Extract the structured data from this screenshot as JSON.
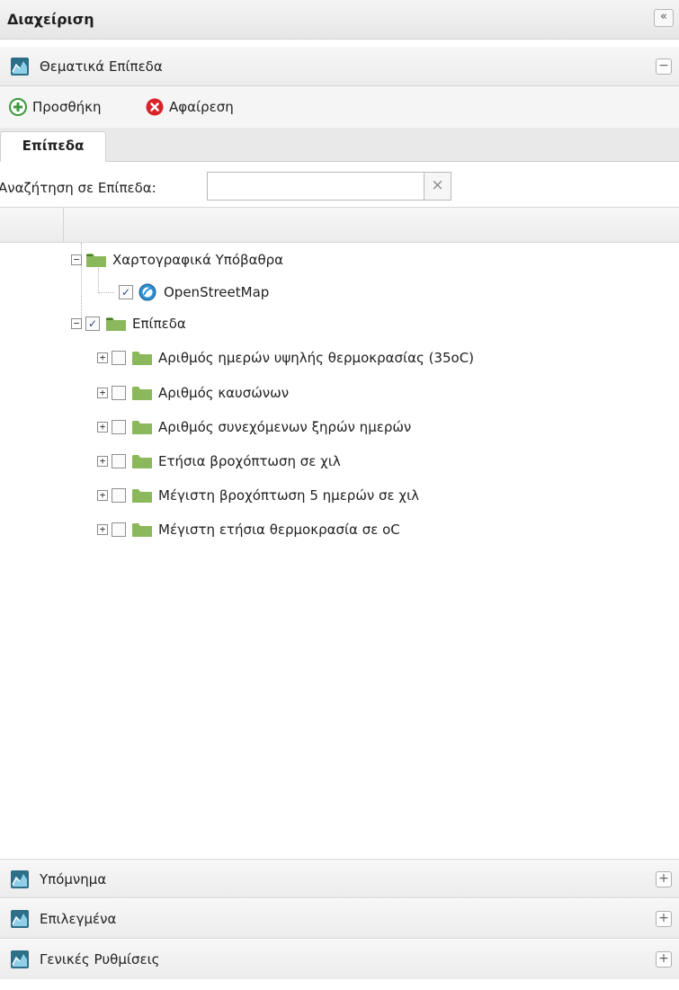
{
  "header": {
    "title": "Διαχείριση",
    "collapse_symbol": "«"
  },
  "thematic_panel": {
    "title": "Θεματικά Επίπεδα",
    "toggle_symbol": "−"
  },
  "toolbar": {
    "add_label": "Προσθήκη",
    "remove_label": "Αφαίρεση"
  },
  "tabs": [
    {
      "label": "Επίπεδα"
    }
  ],
  "search": {
    "label": "Αναζήτηση σε Επίπεδα:",
    "value": "",
    "placeholder": "",
    "clear_symbol": "×"
  },
  "tree": {
    "basemaps": {
      "label": "Χαρτογραφικά Υπόβαθρα",
      "expander": "−",
      "children": [
        {
          "label": "OpenStreetMap",
          "checked": "✓"
        }
      ]
    },
    "layers": {
      "label": "Επίπεδα",
      "expander": "−",
      "checked": "✓",
      "children": [
        {
          "label": "Αριθμός ημερών υψηλής θερμοκρασίας (35oC)",
          "expander": "+"
        },
        {
          "label": "Αριθμός καυσώνων",
          "expander": "+"
        },
        {
          "label": "Αριθμός συνεχόμενων ξηρών ημερών",
          "expander": "+"
        },
        {
          "label": "Ετήσια βροχόπτωση σε χιλ",
          "expander": "+"
        },
        {
          "label": "Μέγιστη βροχόπτωση 5 ημερών σε χιλ",
          "expander": "+"
        },
        {
          "label": "Μέγιστη ετήσια θερμοκρασία σε oC",
          "expander": "+"
        }
      ]
    }
  },
  "bottom_panels": [
    {
      "title": "Υπόμνημα",
      "toggle_symbol": "+"
    },
    {
      "title": "Επιλεγμένα",
      "toggle_symbol": "+"
    },
    {
      "title": "Γενικές Ρυθμίσεις",
      "toggle_symbol": "+"
    }
  ],
  "colors": {
    "folder_green": "#8bb85a",
    "folder_tab": "#4f7d2f",
    "add_green": "#3c9a3c",
    "remove_red": "#d9232b",
    "globe_blue": "#2a8fd4",
    "panel_icon_bg": "#2d6e88"
  },
  "icons": {
    "panel": "map-layers-icon",
    "add": "add-circle-icon",
    "remove": "remove-circle-icon",
    "folder": "folder-icon",
    "globe": "globe-icon"
  }
}
